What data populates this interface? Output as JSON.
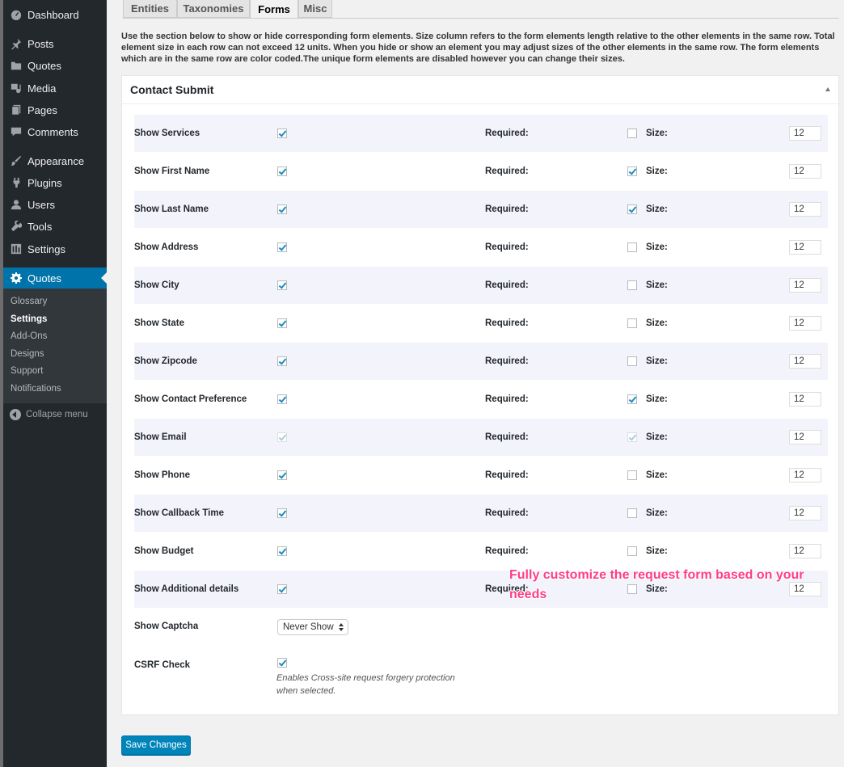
{
  "sidebar": {
    "items": [
      {
        "label": "Dashboard",
        "icon": "dashboard-icon"
      },
      {
        "label": "Posts",
        "icon": "pin-icon"
      },
      {
        "label": "Quotes",
        "icon": "folder-icon"
      },
      {
        "label": "Media",
        "icon": "media-icon"
      },
      {
        "label": "Pages",
        "icon": "pages-icon"
      },
      {
        "label": "Comments",
        "icon": "comment-icon"
      },
      {
        "label": "Appearance",
        "icon": "brush-icon"
      },
      {
        "label": "Plugins",
        "icon": "plugin-icon"
      },
      {
        "label": "Users",
        "icon": "user-icon"
      },
      {
        "label": "Tools",
        "icon": "wrench-icon"
      },
      {
        "label": "Settings",
        "icon": "settings-icon"
      },
      {
        "label": "Quotes",
        "icon": "gear-icon"
      }
    ],
    "submenu": [
      "Glossary",
      "Settings",
      "Add-Ons",
      "Designs",
      "Support",
      "Notifications"
    ],
    "collapse_label": "Collapse menu"
  },
  "tabs": [
    "Entities",
    "Taxonomies",
    "Forms",
    "Misc"
  ],
  "active_tab": "Forms",
  "intro": "Use the section below to show or hide corresponding form elements. Size column refers to the form elements length relative to the other elements in the same row. Total element size in each row can not exceed 12 units. When you hide or show an element you may adjust sizes of the other elements in the same row. The form elements which are in the same row are color coded.The unique form elements are disabled however you can change their sizes.",
  "section": {
    "title": "Contact Submit",
    "required_label": "Required:",
    "size_label": "Size:",
    "rows": [
      {
        "label": "Show Services",
        "show": true,
        "required": false,
        "size": "12",
        "disabled": false
      },
      {
        "label": "Show First Name",
        "show": true,
        "required": true,
        "size": "12",
        "disabled": false
      },
      {
        "label": "Show Last Name",
        "show": true,
        "required": true,
        "size": "12",
        "disabled": false
      },
      {
        "label": "Show Address",
        "show": true,
        "required": false,
        "size": "12",
        "disabled": false
      },
      {
        "label": "Show City",
        "show": true,
        "required": false,
        "size": "12",
        "disabled": false
      },
      {
        "label": "Show State",
        "show": true,
        "required": false,
        "size": "12",
        "disabled": false
      },
      {
        "label": "Show Zipcode",
        "show": true,
        "required": false,
        "size": "12",
        "disabled": false
      },
      {
        "label": "Show Contact Preference",
        "show": true,
        "required": true,
        "size": "12",
        "disabled": false
      },
      {
        "label": "Show Email",
        "show": true,
        "required": true,
        "size": "12",
        "disabled": true
      },
      {
        "label": "Show Phone",
        "show": true,
        "required": false,
        "size": "12",
        "disabled": false
      },
      {
        "label": "Show Callback Time",
        "show": true,
        "required": false,
        "size": "12",
        "disabled": false
      },
      {
        "label": "Show Budget",
        "show": true,
        "required": false,
        "size": "12",
        "disabled": false
      },
      {
        "label": "Show Additional details",
        "show": true,
        "required": false,
        "size": "12",
        "disabled": false
      }
    ],
    "captcha_label": "Show Captcha",
    "captcha_value": "Never Show",
    "csrf_label": "CSRF Check",
    "csrf_checked": true,
    "csrf_hint": "Enables Cross-site request forgery protection when selected."
  },
  "callout": "Fully customize the request form based on your needs",
  "save_label": "Save Changes",
  "colors": {
    "accent": "#0073aa",
    "sidebar": "#23282d",
    "callout": "#ff3d85",
    "row_shade": "#f3f4fb"
  }
}
